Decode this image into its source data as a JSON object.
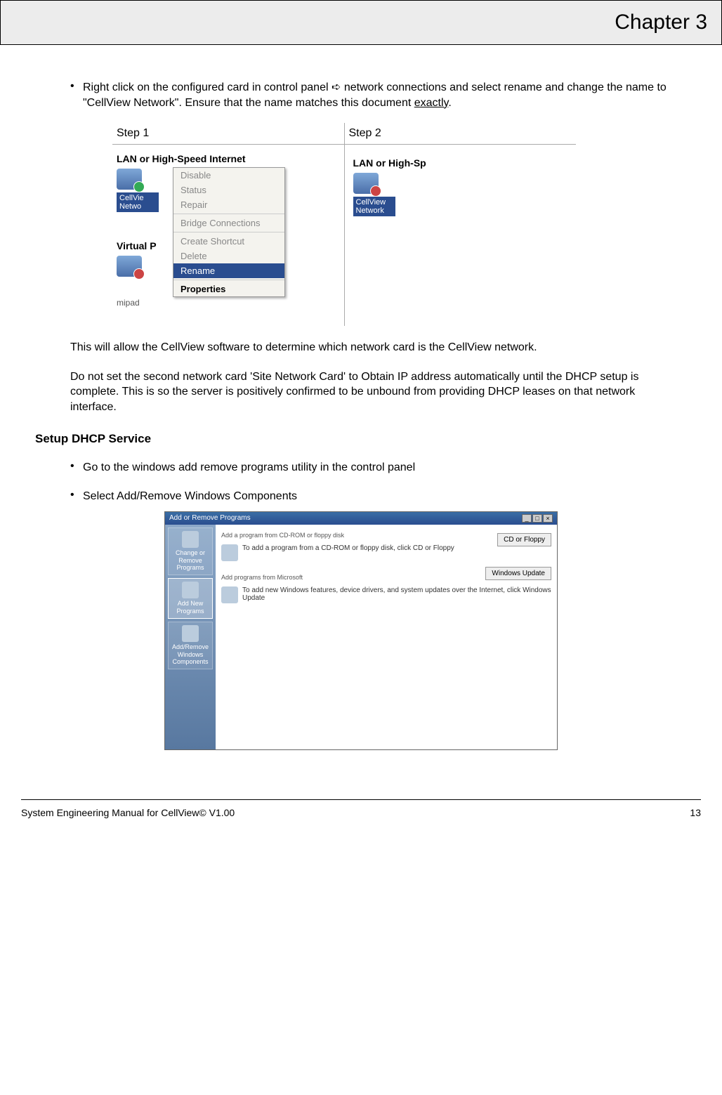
{
  "header": {
    "chapter": "Chapter 3"
  },
  "bullet1": {
    "pre": "Right click on the configured card in control panel ",
    "arrow": "➪",
    "mid": " network connections and select rename and change the name to \"CellView Network\". Ensure that the name matches this document ",
    "ul": "exactly",
    "post": "."
  },
  "steps": {
    "s1": "Step 1",
    "s2": "Step 2"
  },
  "lan_heading1": "LAN or High-Speed Internet",
  "lan_heading2": "LAN or High-Sp",
  "netlabel1a": "CellVie",
  "netlabel1b": "Netwo",
  "vp": "Virtual P",
  "mipad": "mipad",
  "netlabel2a": "CellView",
  "netlabel2b": "Network",
  "ctx": {
    "disable": "Disable",
    "status": "Status",
    "repair": "Repair",
    "bridge": "Bridge Connections",
    "shortcut": "Create Shortcut",
    "delete": "Delete",
    "rename": "Rename",
    "properties": "Properties"
  },
  "para1": "This will allow the CellView software to determine which network card is the CellView network.",
  "para2": "Do not set the second network card 'Site Network Card' to Obtain IP address automatically until the DHCP setup is complete. This is so the server is positively confirmed to be unbound from providing DHCP leases on that network interface.",
  "section": "Setup DHCP Service",
  "bullet2": "Go to the windows add remove programs utility in the control panel",
  "bullet3": "Select Add/Remove Windows Components",
  "arp": {
    "title": "Add or Remove Programs",
    "side1": "Change or Remove Programs",
    "side2": "Add New Programs",
    "side3": "Add/Remove Windows Components",
    "h1": "Add a program from CD-ROM or floppy disk",
    "t1": "To add a program from a CD-ROM or floppy disk, click CD or Floppy",
    "h2": "Add programs from Microsoft",
    "t2": "To add new Windows features, device drivers, and system updates over the Internet, click Windows Update",
    "btn1": "CD or Floppy",
    "btn2": "Windows Update"
  },
  "footer": {
    "left": "System Engineering Manual for CellView© V1.00",
    "right": "13"
  }
}
